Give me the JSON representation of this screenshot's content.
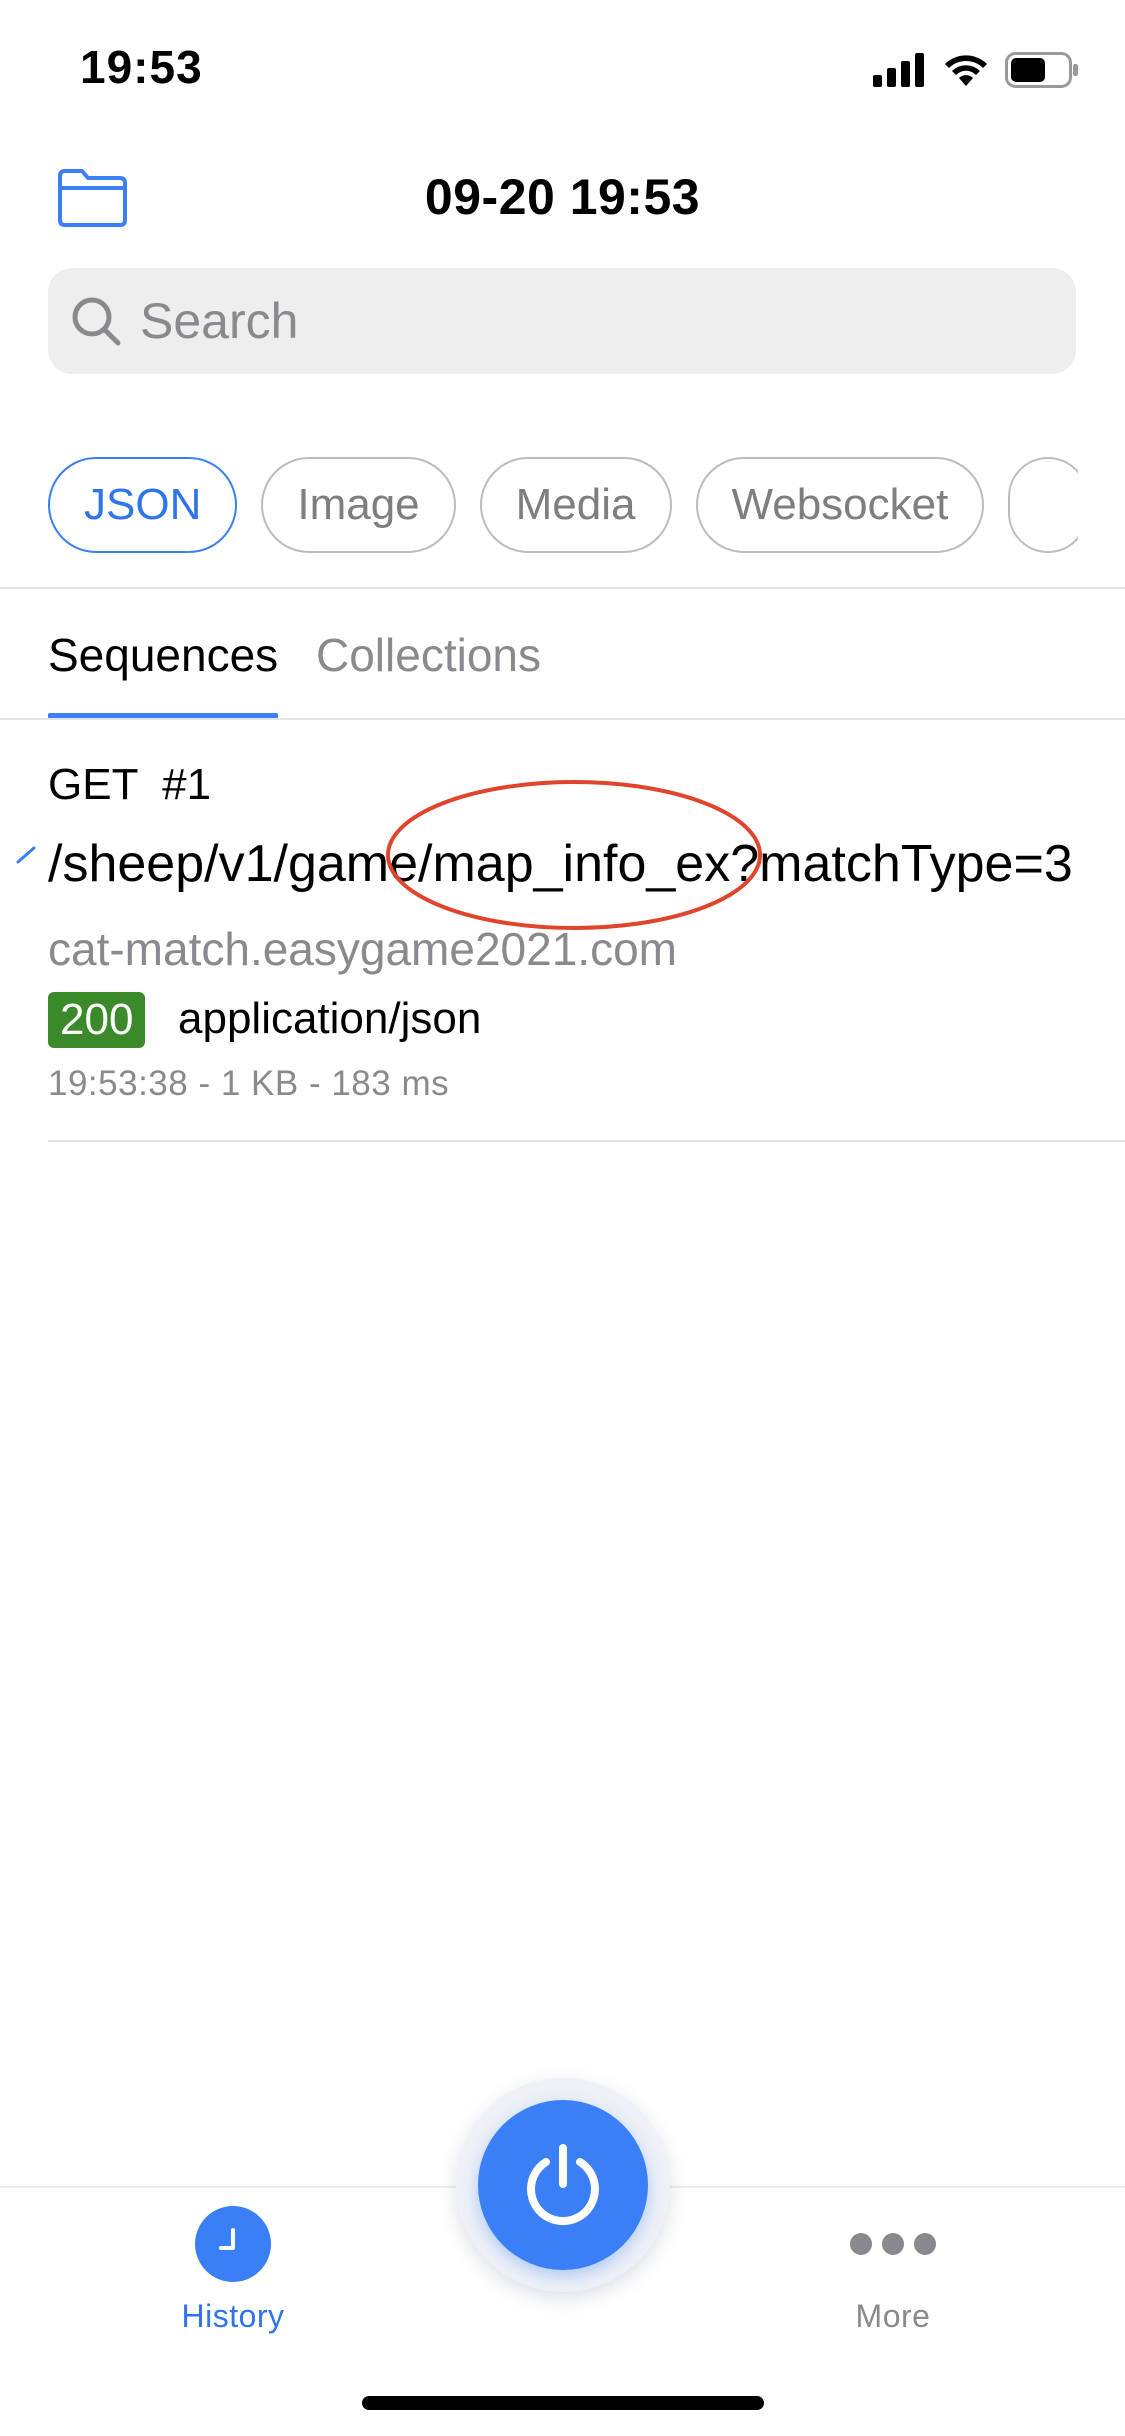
{
  "status_bar": {
    "time": "19:53",
    "icons": [
      "signal-icon",
      "wifi-icon",
      "battery-icon"
    ]
  },
  "header": {
    "title": "09-20 19:53",
    "left_icon": "folder-icon"
  },
  "search": {
    "placeholder": "Search",
    "value": ""
  },
  "filters": {
    "items": [
      "JSON",
      "Image",
      "Media",
      "Websocket",
      ""
    ],
    "selected": "JSON"
  },
  "tabs": {
    "items": [
      "Sequences",
      "Collections"
    ],
    "selected": "Sequences"
  },
  "requests": [
    {
      "method_number": "GET  #1",
      "path": "/sheep/v1/game/map_info_ex?matchType=3",
      "host": "cat-match.easygame2021.com",
      "status": "200",
      "content_type": "application/json",
      "meta": "19:53:38 - 1 KB - 183 ms"
    }
  ],
  "tab_bar": {
    "history_label": "History",
    "more_label": "More",
    "power_icon": "power-icon"
  },
  "colors": {
    "accent": "#3a7ff6",
    "status_ok": "#3b8a2a",
    "annotation": "#e0442c",
    "muted_text": "#8a8a8e"
  }
}
